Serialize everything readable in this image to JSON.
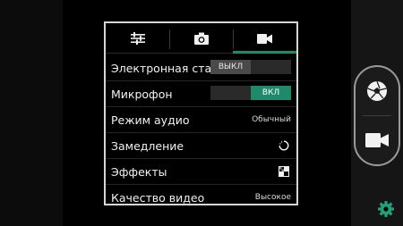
{
  "settings": {
    "tabs": [
      {
        "icon": "sliders-icon"
      },
      {
        "icon": "camera-icon"
      },
      {
        "icon": "video-camera-icon"
      }
    ],
    "rows": [
      {
        "label": "Электронная стаб",
        "value": "ВЫКЛ"
      },
      {
        "label": "Микрофон",
        "value": "ВКЛ"
      },
      {
        "label": "Режим аудио",
        "value": "Обычный"
      },
      {
        "label": "Замедление",
        "icon": "slow-motion-icon"
      },
      {
        "label": "Эффекты",
        "icon": "effects-icon"
      },
      {
        "label": "Качество видео",
        "value": "Высокое"
      }
    ]
  },
  "colors": {
    "accent": "#1f8a6b",
    "settings_button": "#22a07a"
  },
  "controls": {
    "shutter_icon": "shutter-aperture-icon",
    "video_icon": "video-camera-icon",
    "settings_icon": "gear-icon"
  }
}
